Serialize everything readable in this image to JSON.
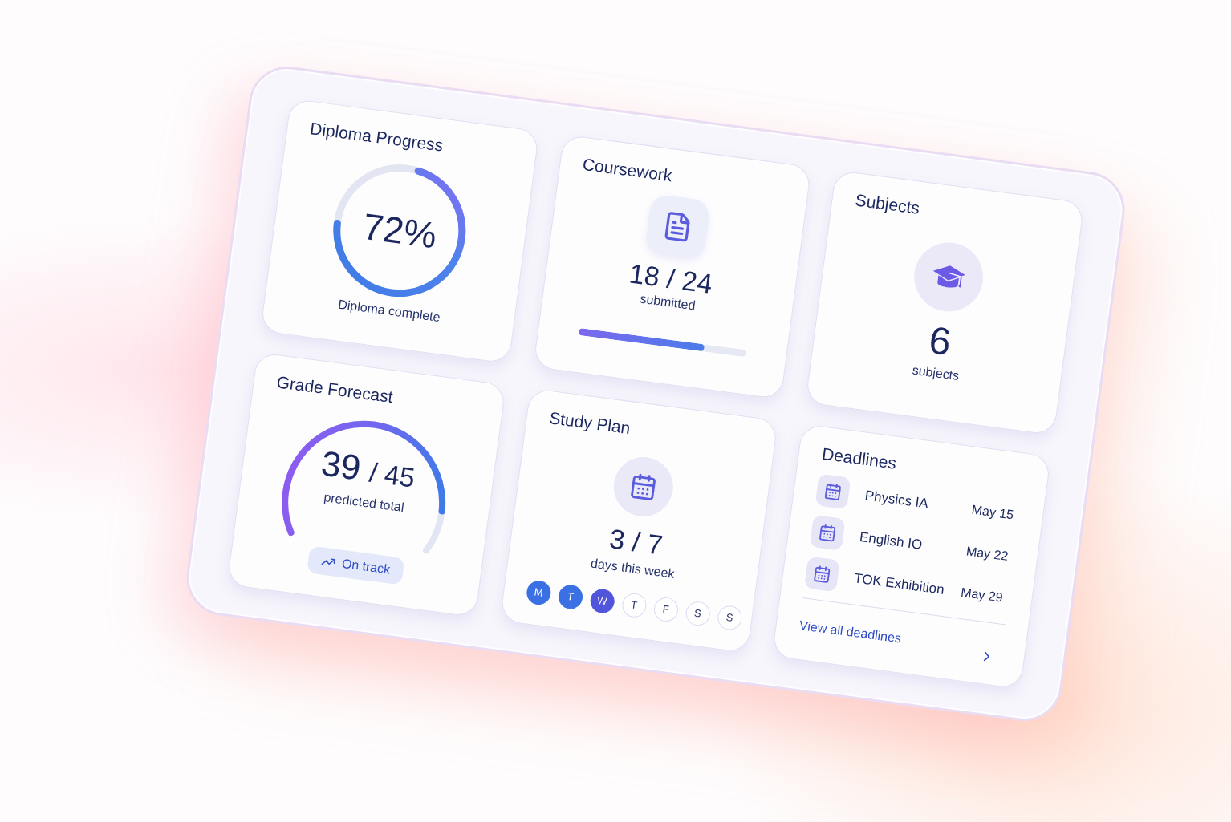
{
  "cards": [
    {
      "kind": "ring",
      "title": "Diploma Progress",
      "value": "72%",
      "level": 0.72,
      "caption": "Diploma complete"
    },
    {
      "kind": "bar",
      "title": "Coursework",
      "value": "18 / 24",
      "caption": "submitted",
      "level": 0.75
    },
    {
      "kind": "count",
      "title": "Subjects",
      "value": "6",
      "caption": "subjects"
    },
    {
      "kind": "gauge",
      "title": "Grade Forecast",
      "value": "39",
      "total": "/ 45",
      "caption": "predicted total",
      "level": 0.87,
      "badge": "On track"
    },
    {
      "kind": "week",
      "title": "Study Plan",
      "value": "3 / 7",
      "caption": "days this week",
      "days": [
        {
          "label": "M",
          "done": true,
          "today": false
        },
        {
          "label": "T",
          "done": true,
          "today": false
        },
        {
          "label": "W",
          "done": true,
          "today": true
        },
        {
          "label": "T",
          "done": false,
          "today": false
        },
        {
          "label": "F",
          "done": false,
          "today": false
        },
        {
          "label": "S",
          "done": false,
          "today": false
        },
        {
          "label": "S",
          "done": false,
          "today": false
        }
      ]
    },
    {
      "kind": "list",
      "title": "Deadlines",
      "items": [
        {
          "name": "Physics IA",
          "date": "May 15"
        },
        {
          "name": "English IO",
          "date": "May 22"
        },
        {
          "name": "TOK Exhibition",
          "date": "May 29"
        }
      ],
      "link": "View all deadlines"
    }
  ]
}
